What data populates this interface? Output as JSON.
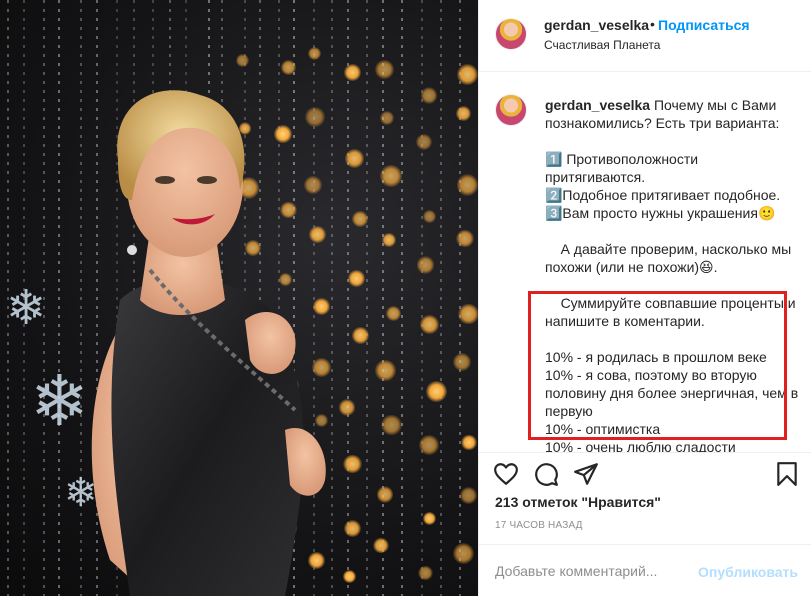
{
  "post": {
    "username": "gerdan_veselka",
    "separator": "•",
    "follow_label": "Подписаться",
    "location": "Счастливая Планета"
  },
  "caption": {
    "username": "gerdan_veselka",
    "text": " Почему мы с Вами познакомились? Есть три варианта:\n\n1️⃣ Противоположности притягиваются.\n2️⃣Подобное притягивает подобное.\n3️⃣Вам просто нужны украшения🙂\n\n    А давайте проверим, насколько мы похожи (или не похожи)😆.\n\n    Суммируйте совпавшие проценты и напишите в коментарии.\n\n10% - я родилась в прошлом веке\n10% - я сова, поэтому во вторую половину дня более энергичная, чем в первую\n10% - оптимистка\n10% - очень люблю сладости"
  },
  "actions": {
    "like_icon": "heart-icon",
    "comment_icon": "comment-icon",
    "share_icon": "share-icon",
    "save_icon": "bookmark-icon"
  },
  "likes": "213 отметок \"Нравится\"",
  "timestamp": "17 ЧАСОВ НАЗАД",
  "comment": {
    "placeholder": "Добавьте комментарий...",
    "post_label": "Опубликовать"
  },
  "colors": {
    "accent": "#0095f6",
    "post_disabled": "#b2dffc",
    "highlight_box": "#e0201f"
  }
}
